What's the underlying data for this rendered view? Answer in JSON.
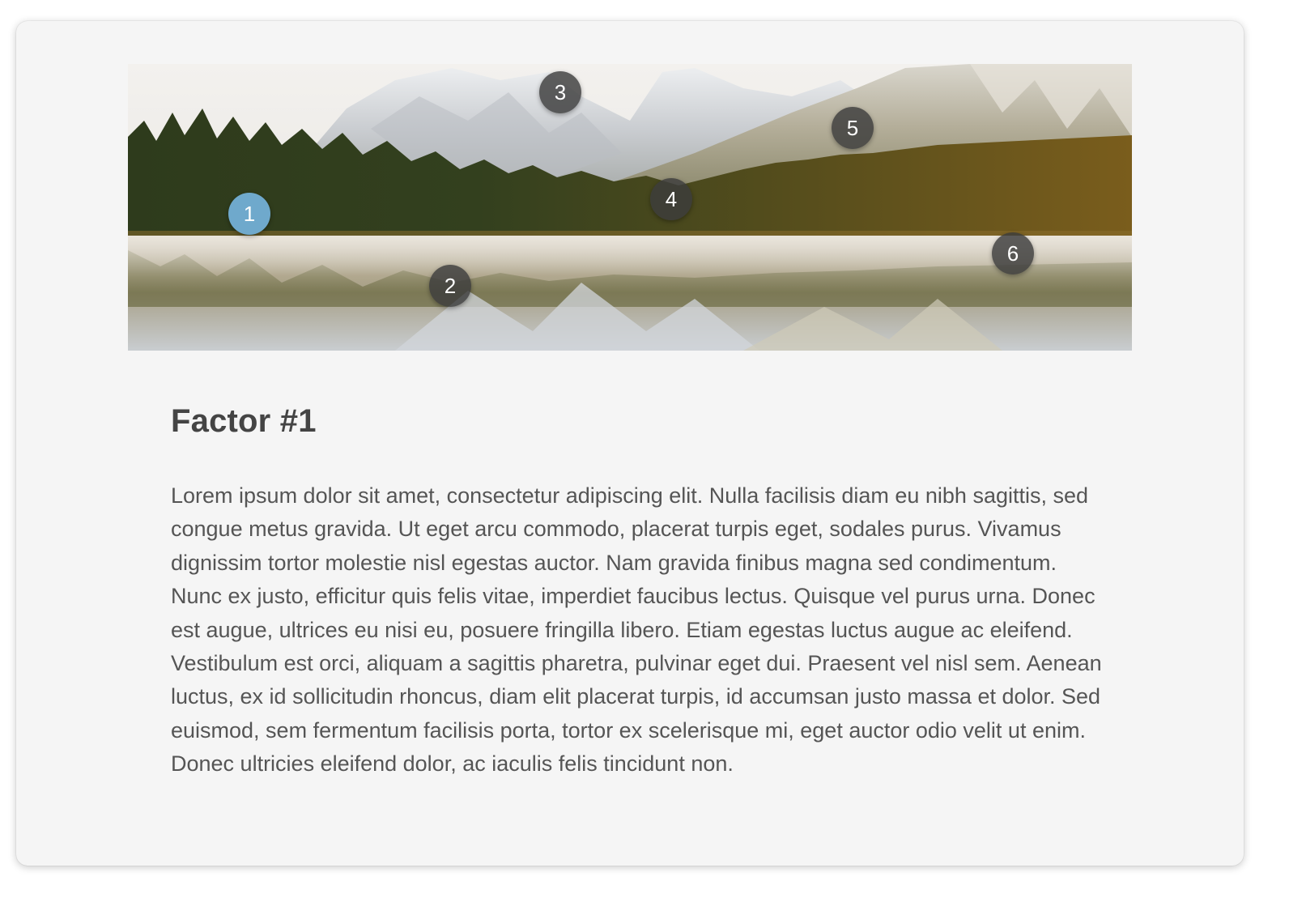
{
  "hero": {
    "hotspots": [
      {
        "label": "1",
        "active": true
      },
      {
        "label": "2",
        "active": false
      },
      {
        "label": "3",
        "active": false
      },
      {
        "label": "4",
        "active": false
      },
      {
        "label": "5",
        "active": false
      },
      {
        "label": "6",
        "active": false
      }
    ]
  },
  "factor": {
    "title": "Factor #1",
    "body": "Lorem ipsum dolor sit amet, consectetur adipiscing elit. Nulla facilisis diam eu nibh sagittis, sed congue metus gravida. Ut eget arcu commodo, placerat turpis eget, sodales purus. Vivamus dignissim tortor molestie nisl egestas auctor. Nam gravida finibus magna sed condimentum. Nunc ex justo, efficitur quis felis vitae, imperdiet faucibus lectus. Quisque vel purus urna. Donec est augue, ultrices eu nisi eu, posuere fringilla libero. Etiam egestas luctus augue ac eleifend. Vestibulum est orci, aliquam a sagittis pharetra, pulvinar eget dui. Praesent vel nisl sem. Aenean luctus, ex id sollicitudin rhoncus, diam elit placerat turpis, id accumsan justo massa et dolor. Sed euismod, sem fermentum facilisis porta, tortor ex scelerisque mi, eget auctor odio velit ut enim. Donec ultricies eleifend dolor, ac iaculis felis tincidunt non."
  },
  "colors": {
    "active_hotspot": "#6fa9cc",
    "inactive_hotspot": "#3c3c3c",
    "card_background": "#f5f5f5",
    "heading_text": "#444444",
    "body_text": "#555555"
  }
}
